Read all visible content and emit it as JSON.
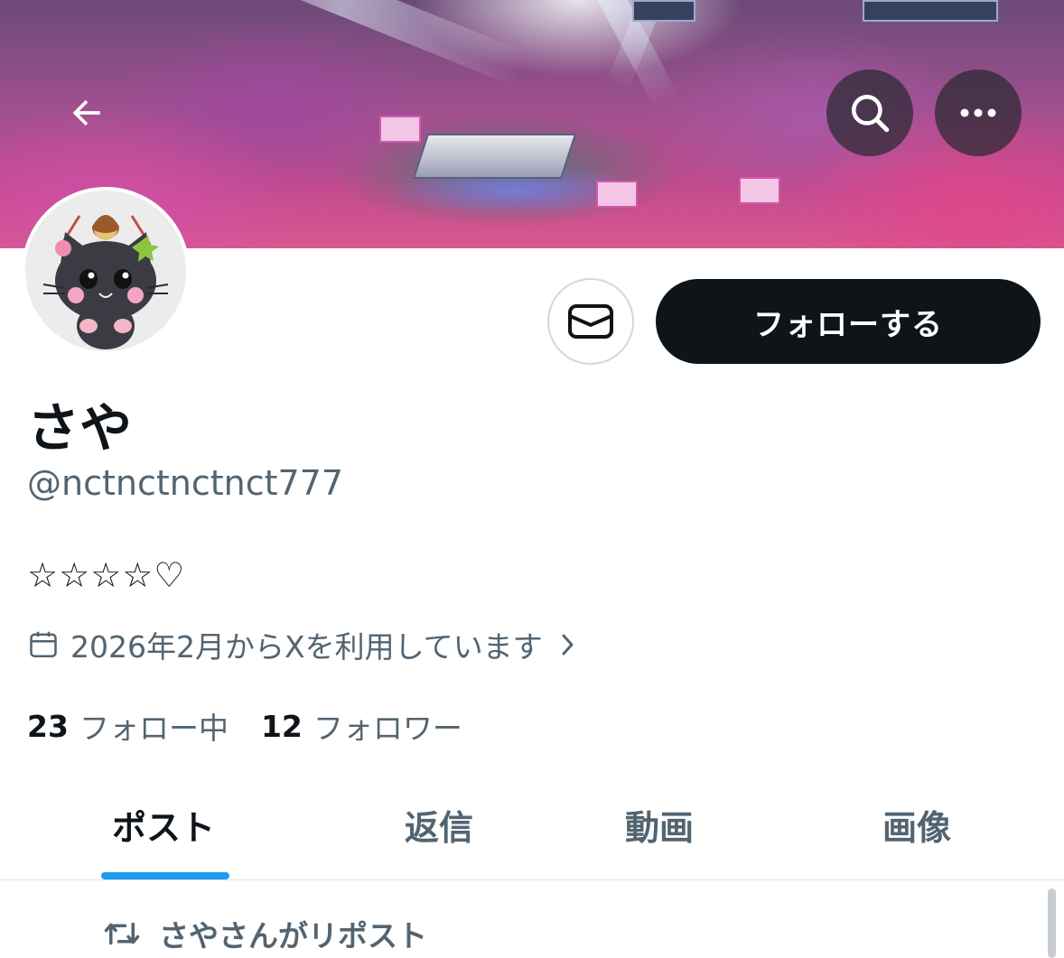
{
  "banner": {
    "back_icon": "arrow-left-icon",
    "search_icon": "search-icon",
    "more_icon": "more-horizontal-icon"
  },
  "actions": {
    "message_icon": "envelope-icon",
    "follow_label": "フォローする"
  },
  "profile": {
    "display_name": "さや",
    "handle": "@nctnctnctnct777",
    "bio": "☆☆☆☆♡",
    "joined_icon": "calendar-icon",
    "joined_text": "2026年2月からXを利用しています",
    "following_count": "23",
    "following_label": "フォロー中",
    "followers_count": "12",
    "followers_label": "フォロワー"
  },
  "tabs": [
    {
      "label": "ポスト",
      "active": true
    },
    {
      "label": "返信",
      "active": false
    },
    {
      "label": "動画",
      "active": false
    },
    {
      "label": "画像",
      "active": false
    }
  ],
  "feed": {
    "repost_icon": "repost-icon",
    "repost_text": "さやさんがリポスト"
  },
  "colors": {
    "accent": "#1d9bf0",
    "text_primary": "#0f1419",
    "text_secondary": "#536471",
    "button_dark": "#0f1419",
    "divider": "#dfe3e6"
  }
}
